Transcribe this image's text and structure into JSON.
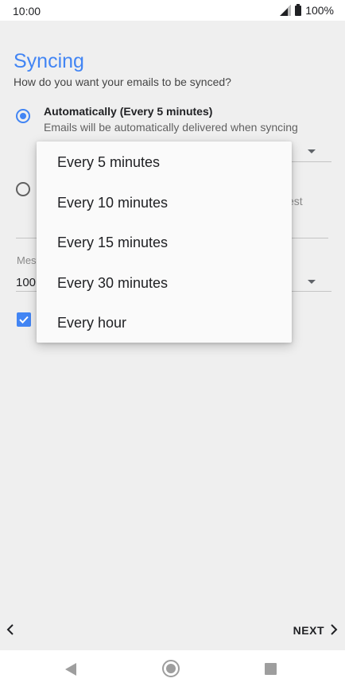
{
  "status_bar": {
    "time": "10:00",
    "battery": "100%"
  },
  "header": {
    "title": "Syncing",
    "subtitle": "How do you want your emails to be synced?"
  },
  "sync_options": {
    "automatic": {
      "label": "Automatically (Every 5 minutes)",
      "description": "Emails will be automatically delivered when syncing",
      "selected": true
    },
    "manual": {
      "partial_text": "est",
      "selected": false
    }
  },
  "message_setting": {
    "partial_label": "Mes",
    "partial_value": "100"
  },
  "checkbox": {
    "checked": true
  },
  "interval_menu": {
    "items": [
      "Every 5 minutes",
      "Every 10 minutes",
      "Every 15 minutes",
      "Every 30 minutes",
      "Every hour"
    ]
  },
  "footer": {
    "next_label": "NEXT"
  },
  "icons": {
    "signal": "signal-icon",
    "battery": "battery-icon",
    "back": "chevron-left-icon",
    "next": "chevron-right-icon"
  },
  "colors": {
    "accent": "#4285f4",
    "background": "#efefef",
    "menu_background": "#fafafa"
  }
}
